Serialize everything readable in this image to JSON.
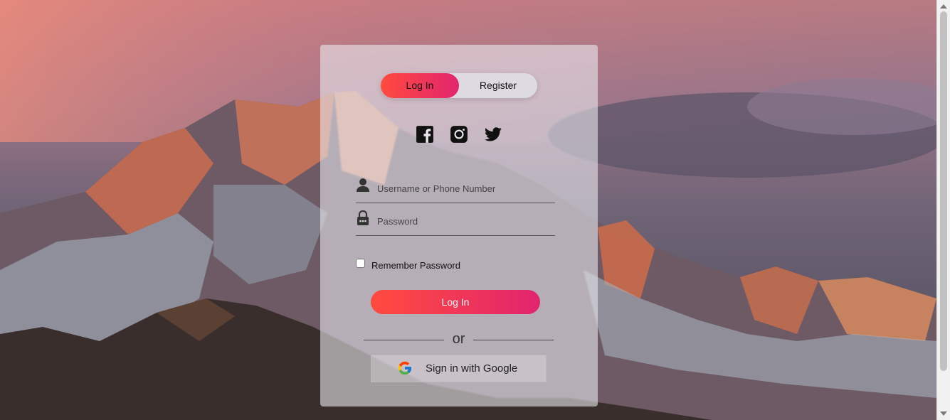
{
  "tabs": {
    "login_label": "Log In",
    "register_label": "Register"
  },
  "social": [
    "facebook-icon",
    "instagram-icon",
    "twitter-icon"
  ],
  "form": {
    "username_placeholder": "Username or Phone Number",
    "password_placeholder": "Password",
    "remember_label": "Remember Password",
    "remember_checked": false,
    "submit_label": "Log In"
  },
  "divider": {
    "text": "or"
  },
  "google": {
    "label": "Sign in with Google"
  },
  "colors": {
    "accent_start": "#ff4b3e",
    "accent_end": "#e2246f"
  }
}
